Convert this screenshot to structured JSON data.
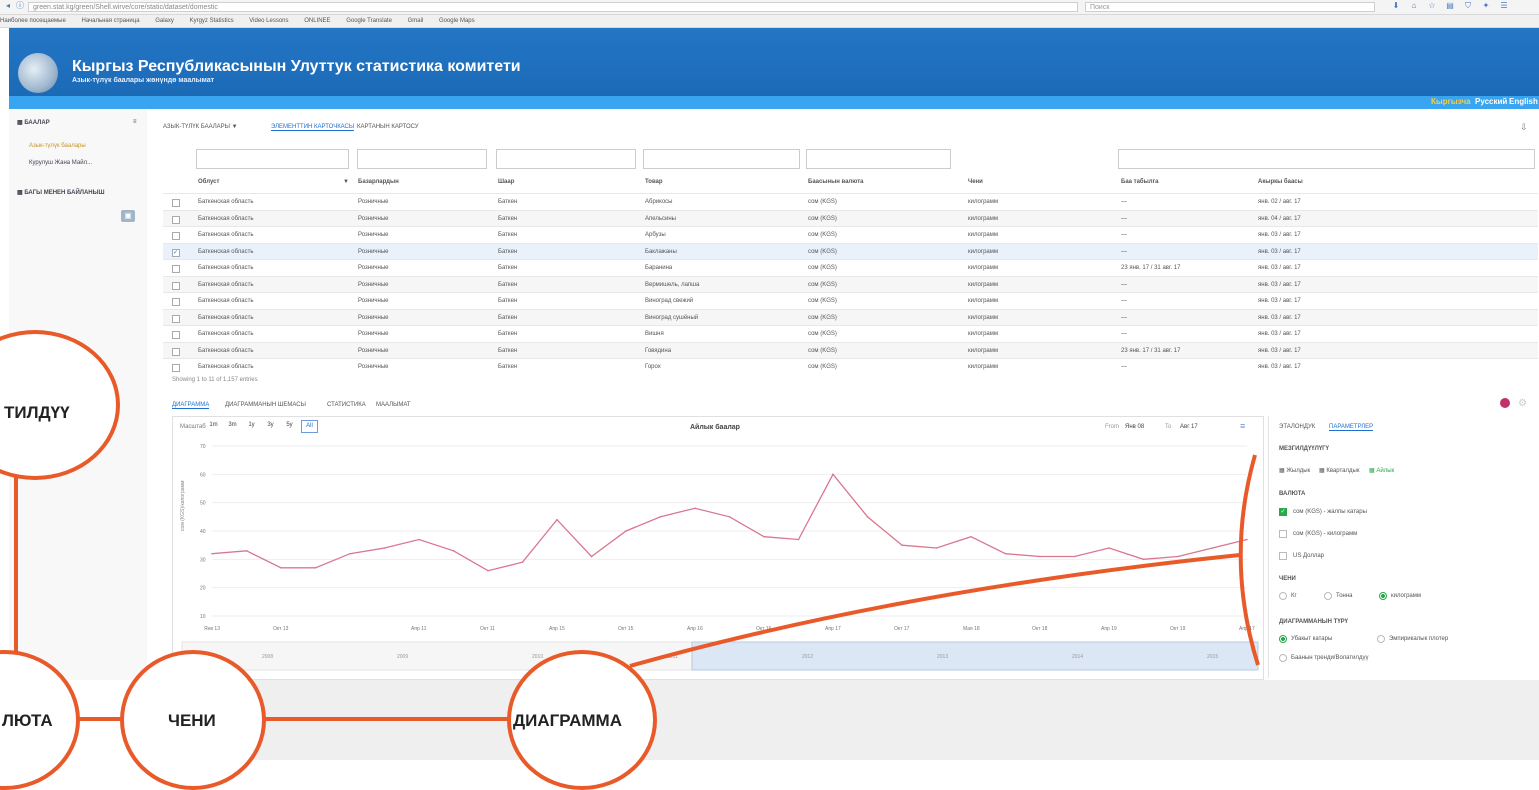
{
  "browser": {
    "url": "green.stat.kg/green/Shell.wirve/core/static/dataset/domestic",
    "search_placeholder": "Поиск",
    "bookmarks": [
      "Наиболее посещаемые",
      "Начальная страница",
      "Galaxy",
      "Kyrgyz Statistics",
      "Video Lessons",
      "ONLINEЕ",
      "Google Translate",
      "Gmail",
      "Google Maps"
    ]
  },
  "site": {
    "title": "Кыргыз Республикасынын Улуттук статистика комитети",
    "subtitle": "Азык-түлүк баалары жөнүндө маалымат",
    "lang": [
      "Кыргызча",
      "Русский",
      "English"
    ]
  },
  "sidebar": {
    "header": "БААЛАР",
    "items": [
      "Азык-түлүк баалары",
      "Курулуш Жана Майл..."
    ],
    "section2": "БАГЫ МЕНЕН БАЙЛАНЫШ"
  },
  "tabs": [
    "АЗЫК-ТҮЛҮК БААЛАРЫ ▼",
    "ЭЛЕМЕНТТИН КАРТОЧКАСЫ",
    "КАРТАНЫН КАРТОСУ"
  ],
  "table": {
    "headers": [
      "Облуст",
      "Базарлардын",
      "Шаар",
      "Товар",
      "Баасынын валюта",
      "Чени",
      "Баа табылга",
      "Акыркы баасы"
    ],
    "rows": [
      [
        "Баткенская область",
        "Розничные",
        "Баткен",
        "Абрикосы",
        "сом (KGS)",
        "килограмм",
        "—",
        "янв. 02 / авг. 17"
      ],
      [
        "Баткенская область",
        "Розничные",
        "Баткен",
        "Апельсины",
        "сом (KGS)",
        "килограмм",
        "—",
        "янв. 04 / авг. 17"
      ],
      [
        "Баткенская область",
        "Розничные",
        "Баткен",
        "Арбузы",
        "сом (KGS)",
        "килограмм",
        "—",
        "янв. 03 / авг. 17"
      ],
      [
        "Баткенская область",
        "Розничные",
        "Баткен",
        "Баклажаны",
        "сом (KGS)",
        "килограмм",
        "—",
        "янв. 03 / авг. 17"
      ],
      [
        "Баткенская область",
        "Розничные",
        "Баткен",
        "Баранина",
        "сом (KGS)",
        "килограмм",
        "23 янв. 17 / 31 авг. 17",
        "янв. 03 / авг. 17"
      ],
      [
        "Баткенская область",
        "Розничные",
        "Баткен",
        "Вермишель, лапша",
        "сом (KGS)",
        "килограмм",
        "—",
        "янв. 03 / авг. 17"
      ],
      [
        "Баткенская область",
        "Розничные",
        "Баткен",
        "Виноград свежий",
        "сом (KGS)",
        "килограмм",
        "—",
        "янв. 03 / авг. 17"
      ],
      [
        "Баткенская область",
        "Розничные",
        "Баткен",
        "Виноград сушёный",
        "сом (KGS)",
        "килограмм",
        "—",
        "янв. 03 / авг. 17"
      ],
      [
        "Баткенская область",
        "Розничные",
        "Баткен",
        "Вишня",
        "сом (KGS)",
        "килограмм",
        "—",
        "янв. 03 / авг. 17"
      ],
      [
        "Баткенская область",
        "Розничные",
        "Баткен",
        "Говядина",
        "сом (KGS)",
        "килограмм",
        "23 янв. 17 / 31 авг. 17",
        "янв. 03 / авг. 17"
      ],
      [
        "Баткенская область",
        "Розничные",
        "Баткен",
        "Горох",
        "сом (KGS)",
        "килограмм",
        "—",
        "янв. 03 / авг. 17"
      ]
    ],
    "footer": "Showing 1 to 11 of 1,157 entries"
  },
  "bottom_tabs": [
    "ДИАГРАММА",
    "ДИАГРАММАНЫН ШЕМАСЫ",
    "СТАТИСТИКА",
    "МААЛЫМАТ"
  ],
  "chart_controls": {
    "zoom_label": "Масштаб",
    "zoom_buttons": [
      "1m",
      "3m",
      "1y",
      "3y",
      "5y",
      "All"
    ],
    "title": "Айлык баалар",
    "from_label": "From",
    "from_value": "Янв 08",
    "to_label": "To",
    "to_value": "Авг 17"
  },
  "chart_data": {
    "type": "line",
    "title": "Айлык баалар",
    "ylabel": "сом (KGS)/килограмм",
    "x": [
      "Янв 13",
      "",
      "Окт 13",
      "",
      "",
      "",
      "Апр 11",
      "",
      "Окт 11",
      "",
      "Апр 15",
      "",
      "Окт 15",
      "",
      "Апр 16",
      "",
      "Окт 16",
      "",
      "Апр 17",
      "",
      "Окт 17",
      "",
      "Мая 18",
      "",
      "Окт 18",
      "",
      "Апр 19",
      "",
      "Окт 19",
      "",
      "Апр 17"
    ],
    "values": [
      32,
      33,
      27,
      27,
      32,
      34,
      37,
      33,
      26,
      29,
      44,
      31,
      40,
      45,
      48,
      45,
      38,
      37,
      60,
      45,
      35,
      34,
      38,
      32,
      31,
      31,
      34,
      30,
      31,
      34,
      37
    ],
    "yticks": [
      10,
      20,
      30,
      40,
      50,
      60,
      70
    ],
    "ylim": [
      10,
      70
    ],
    "grid": true,
    "color": "#d9778f",
    "navigator_labels": [
      "2008",
      "2009",
      "2010",
      "2011",
      "2012",
      "2013",
      "2014",
      "2015"
    ]
  },
  "right_panel": {
    "tabs": [
      "ЭТАЛОНДУК",
      "ПАРАМЕТРЛЕР"
    ],
    "section_period": "МЕЗГИЛДҮҮЛҮГҮ",
    "periods": [
      "Жылдык",
      "Кварталдык",
      "Айлык"
    ],
    "section_currency": "ВАЛЮТА",
    "currencies": [
      "сом (KGS) - жалпы катары",
      "сом (KGS) - килограмм",
      "US Доллар"
    ],
    "section_unit": "ЧЕНИ",
    "units": [
      "Кг",
      "Тонна",
      "килограмм"
    ],
    "section_type": "ДИАГРАММАНЫН ТҮРҮ",
    "types": [
      "Убакыт катары",
      "Эмпирикалык плотер",
      "Баанын тренди/Волатилдүү"
    ]
  },
  "callouts": {
    "language": "ТИЛДҮҮ",
    "currency": "ЛЮТА",
    "unit": "ЧЕНИ",
    "diagram": "ДИАГРАММА"
  },
  "colors": {
    "header_blue": "#1f70bf",
    "lang_bar": "#39a4f0",
    "accent_orange": "#e85a2a",
    "line_pink": "#d9778f"
  }
}
